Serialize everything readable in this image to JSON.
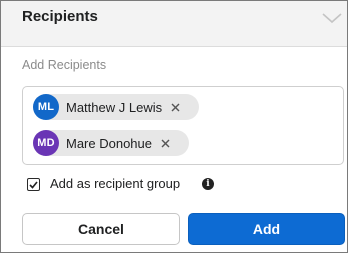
{
  "dialog": {
    "title": "Recipients",
    "collapse_icon": "chevron-down-icon"
  },
  "recipients": {
    "section_label": "Add Recipients",
    "items": [
      {
        "initials": "ML",
        "name": "Matthew J Lewis",
        "avatar_color": "#1268c9",
        "remove_icon": "close-icon"
      },
      {
        "initials": "MD",
        "name": "Mare Donohue",
        "avatar_color": "#6a35b5",
        "remove_icon": "close-icon"
      }
    ]
  },
  "group_option": {
    "label": "Add as recipient group",
    "checked": true,
    "info_icon": "info-icon",
    "info_glyph": "i"
  },
  "actions": {
    "cancel_label": "Cancel",
    "add_label": "Add",
    "primary_color": "#0d6bd3"
  }
}
